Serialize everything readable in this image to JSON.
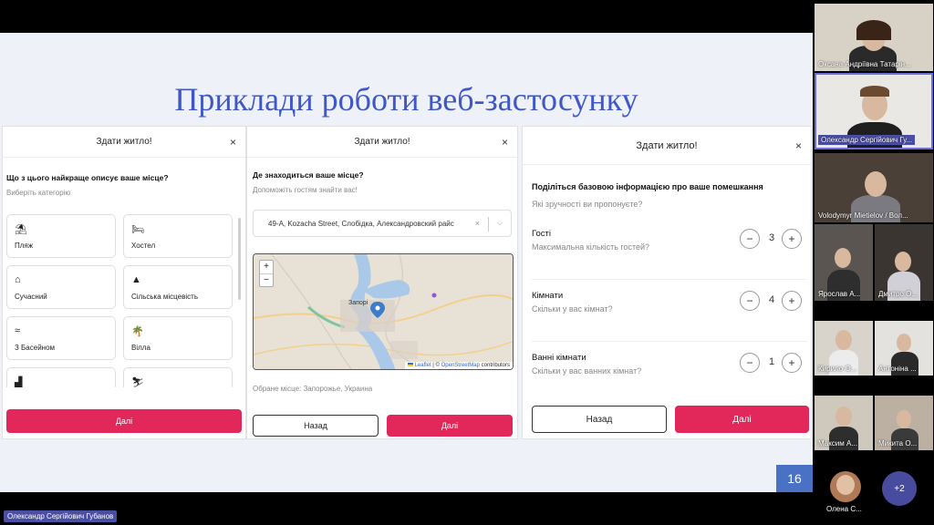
{
  "slide": {
    "title": "Приклади роботи веб-застосунку",
    "page_number": "16"
  },
  "panel1": {
    "header": "Здати житло!",
    "close": "×",
    "question": "Що з цього найкраще описує ваше місце?",
    "subtitle": "Виберіть категорію",
    "categories": [
      {
        "icon": "umbrella-icon",
        "label": "Пляж"
      },
      {
        "icon": "bed-icon",
        "label": "Хостел"
      },
      {
        "icon": "house-icon",
        "label": "Сучасний"
      },
      {
        "icon": "mountain-icon",
        "label": "Сільська місцевість"
      },
      {
        "icon": "pool-icon",
        "label": "З Басейном"
      },
      {
        "icon": "palm-island-icon",
        "label": "Вілла"
      },
      {
        "icon": "stairs-icon",
        "label": ""
      },
      {
        "icon": "skiing-icon",
        "label": ""
      }
    ],
    "next": "Далі"
  },
  "panel2": {
    "header": "Здати житло!",
    "close": "×",
    "question": "Де знаходиться ваше місце?",
    "subtitle": "Допоможіть гостям знайти вас!",
    "address": "49-А, Kozacha Street, Слобідка, Александровский райс",
    "map": {
      "zoom_in": "+",
      "zoom_out": "−",
      "city_label": "Запорі",
      "attr_leaflet": "Leaflet",
      "attr_sep": "| ©",
      "attr_osm": "OpenStreetMap",
      "attr_rest": "contributors"
    },
    "selected_place": "Обране місце: Запорожье, Украина",
    "back": "Назад",
    "next": "Далі"
  },
  "panel3": {
    "header": "Здати житло!",
    "close": "×",
    "question": "Поділіться базовою інформацією про ваше помешкання",
    "subtitle": "Які зручності ви пропонуєте?",
    "rows": [
      {
        "title": "Гості",
        "desc": "Максимальна кількість гостей?",
        "value": "3"
      },
      {
        "title": "Кімнати",
        "desc": "Скільки у вас кімнат?",
        "value": "4"
      },
      {
        "title": "Ванні кімнати",
        "desc": "Скільки у вас ванних кімнат?",
        "value": "1"
      }
    ],
    "minus": "−",
    "plus": "+",
    "back": "Назад",
    "next": "Далі"
  },
  "participants": [
    {
      "name": "Оксана Андріївна Татарін..."
    },
    {
      "name": "Олександр Сергійович Гу..."
    },
    {
      "name": "Volodymyr Mietielov / Вол..."
    },
    {
      "name": "Ярослав А..."
    },
    {
      "name": "Дмитро О..."
    },
    {
      "name": "Кирило О..."
    },
    {
      "name": "Антоніна ..."
    },
    {
      "name": "Максим А..."
    },
    {
      "name": "Микита О..."
    },
    {
      "name": "Олена С..."
    }
  ],
  "more_participants": "+2",
  "active_speaker": "Олександр Сергійович Губанов"
}
